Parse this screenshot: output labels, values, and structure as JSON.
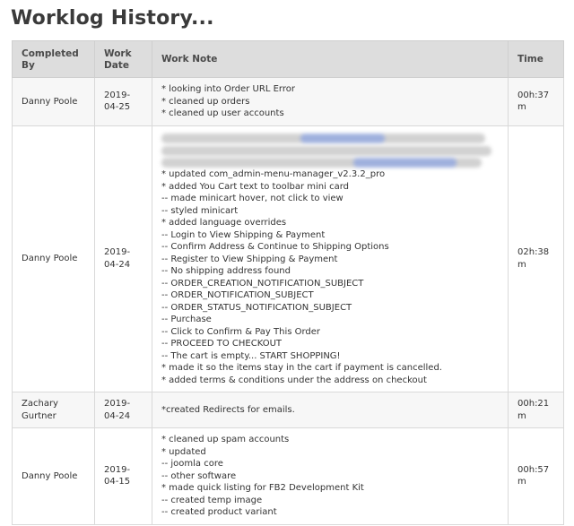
{
  "page": {
    "title": "Worklog History..."
  },
  "table": {
    "headers": {
      "completed_by": "Completed By",
      "work_date": "Work Date",
      "work_note": "Work Note",
      "time": "Time"
    },
    "rows": [
      {
        "completed_by": "Danny Poole",
        "work_date": "2019-04-25",
        "time": "00h:37m",
        "note_lines": [
          "* looking into Order URL Error",
          "* cleaned up orders",
          "* cleaned up user accounts"
        ]
      },
      {
        "completed_by": "Danny Poole",
        "work_date": "2019-04-24",
        "time": "02h:38m",
        "note_lines": [
          "* updated com_admin-menu-manager_v2.3.2_pro",
          "* added You Cart text to toolbar mini card",
          "-- made minicart hover, not click to view",
          "-- styled minicart",
          "* added language overrides",
          "-- Login to View Shipping & Payment",
          "-- Confirm Address & Continue to Shipping Options",
          "-- Register to View Shipping & Payment",
          "-- No shipping address found",
          "-- ORDER_CREATION_NOTIFICATION_SUBJECT",
          "-- ORDER_NOTIFICATION_SUBJECT",
          "-- ORDER_STATUS_NOTIFICATION_SUBJECT",
          "-- Purchase",
          "-- Click to Confirm & Pay This Order",
          "-- PROCEED TO CHECKOUT",
          "-- The cart is empty... START SHOPPING!",
          "* made it so the items stay in the cart if payment is cancelled.",
          "* added terms & conditions under the address on checkout"
        ]
      },
      {
        "completed_by": "Zachary Gurtner",
        "work_date": "2019-04-24",
        "time": "00h:21m",
        "note_lines": [
          "*created Redirects for emails."
        ]
      },
      {
        "completed_by": "Danny Poole",
        "work_date": "2019-04-15",
        "time": "00h:57m",
        "note_lines": [
          "* cleaned up spam accounts",
          "* updated",
          "-- joomla core",
          "-- other software",
          "* made quick listing for FB2 Development Kit",
          "-- created temp image",
          "-- created product variant"
        ]
      }
    ]
  }
}
